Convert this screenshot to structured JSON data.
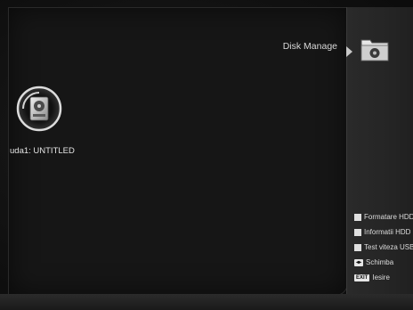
{
  "menu": {
    "title": "Disk Manage",
    "icon": "folder-disk-icon"
  },
  "disk": {
    "label": "uda1: UNTITLED",
    "icon": "hard-disk-icon"
  },
  "legend": {
    "items": [
      {
        "label": "Formatare HDD",
        "icon": "white-square-icon"
      },
      {
        "label": "Informatii HDD",
        "icon": "white-square-icon"
      },
      {
        "label": "Test viteza USB",
        "icon": "white-square-icon"
      },
      {
        "label": "Schimba",
        "key": "◂▸",
        "icon": "arrows-key-icon"
      },
      {
        "label": "Iesire",
        "key": "EXIT",
        "icon": "exit-key-icon"
      }
    ]
  }
}
